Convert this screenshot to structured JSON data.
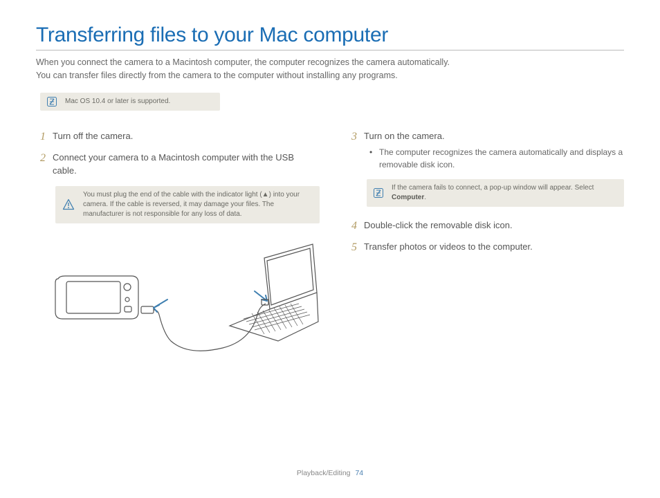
{
  "title": "Transferring files to your Mac computer",
  "intro": [
    "When you connect the camera to a Macintosh computer, the computer recognizes the camera automatically.",
    "You can transfer files directly from the camera to the computer without installing any programs."
  ],
  "topNote": "Mac OS 10.4 or later is supported.",
  "leftSteps": {
    "s1": {
      "num": "1",
      "text": "Turn off the camera."
    },
    "s2": {
      "num": "2",
      "text": "Connect your camera to a Macintosh computer with the USB cable."
    }
  },
  "warning": "You must plug the end of the cable with the indicator light (▲) into your camera. If the cable is reversed, it may damage your files. The manufacturer is not responsible for any loss of data.",
  "rightSteps": {
    "s3": {
      "num": "3",
      "text": "Turn on the camera.",
      "bullet": "The computer recognizes the camera automatically and displays a removable disk icon."
    },
    "s4": {
      "num": "4",
      "text": "Double-click the removable disk icon."
    },
    "s5": {
      "num": "5",
      "text": "Transfer photos or videos to the computer."
    }
  },
  "rightNotePrefix": "If the camera fails to connect, a pop-up window will appear. Select ",
  "rightNoteBold": "Computer",
  "rightNoteSuffix": ".",
  "footer": {
    "section": "Playback/Editing",
    "page": "74"
  }
}
